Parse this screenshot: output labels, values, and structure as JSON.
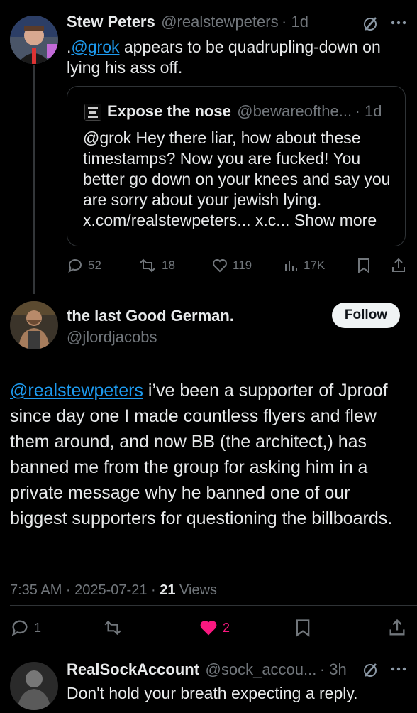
{
  "tweet1": {
    "name": "Stew Peters",
    "handle": "@realstewpeters",
    "time": "· 1d",
    "text_prefix": ".",
    "mention": "@grok",
    "text_rest": " appears to be quadrupling-down on",
    "text_line2": "lying his ass off.",
    "quote": {
      "name": "Expose the nose",
      "handle": "@bewareofthe...",
      "time": "· 1d",
      "lines": [
        "@grok Hey there liar, how about these",
        "timestamps? Now you are fucked! You",
        "better go down on your knees and say you",
        "are sorry about your jewish lying."
      ],
      "last_line": "x.com/realstewpeters... x.c...",
      "show_more": "Show more"
    },
    "actions": {
      "replies": "52",
      "reposts": "18",
      "likes": "119",
      "views": "17K"
    }
  },
  "main_tweet": {
    "name": "the last Good German.",
    "handle": "@jlordjacobs",
    "follow_label": "Follow",
    "mention": "@realstewpeters",
    "text_after_mention": " i’ve been a supporter of Jproof since day one I made countless flyers and flew them around, and now BB (the architect,) has banned me from the group for asking him in a private message why he banned one of our biggest supporters for questioning the billboards.",
    "timestamp": "7:35 AM · 2025-07-21 · ",
    "views_count": "21",
    "views_label": " Views",
    "actions": {
      "replies": "1",
      "likes": "2"
    },
    "colors": {
      "like": "#f91880",
      "link": "#1d9bf0"
    }
  },
  "reply": {
    "name": "RealSockAccount",
    "handle": "@sock_accou...",
    "time": "· 3h",
    "text": "Don't hold your breath expecting a reply."
  },
  "icons": {
    "more": "more-dots-icon",
    "grok": "grok-icon"
  }
}
